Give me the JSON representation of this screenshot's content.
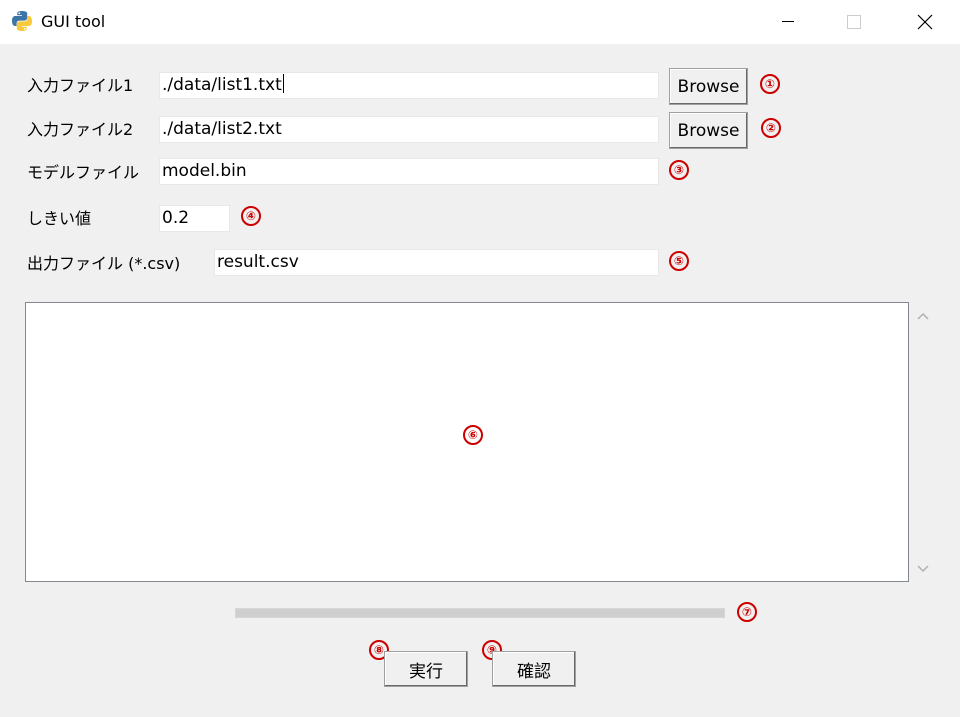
{
  "window": {
    "title": "GUI tool"
  },
  "form": {
    "input1_label": "入力ファイル1",
    "input1_value": "./data/list1.txt",
    "input2_label": "入力ファイル2",
    "input2_value": "./data/list2.txt",
    "model_label": "モデルファイル",
    "model_value": "model.bin",
    "threshold_label": "しきい値",
    "threshold_value": "0.2",
    "output_label": "出力ファイル (*.csv)",
    "output_value": "result.csv",
    "browse_label": "Browse"
  },
  "progress": {
    "value": 0
  },
  "actions": {
    "run_label": "実行",
    "confirm_label": "確認"
  },
  "markers": [
    "①",
    "②",
    "③",
    "④",
    "⑤",
    "⑥",
    "⑦",
    "⑧",
    "⑨"
  ],
  "colors": {
    "marker": "#cc0000",
    "window_bg": "#f0f0f0",
    "titlebar_bg": "#ffffff"
  }
}
